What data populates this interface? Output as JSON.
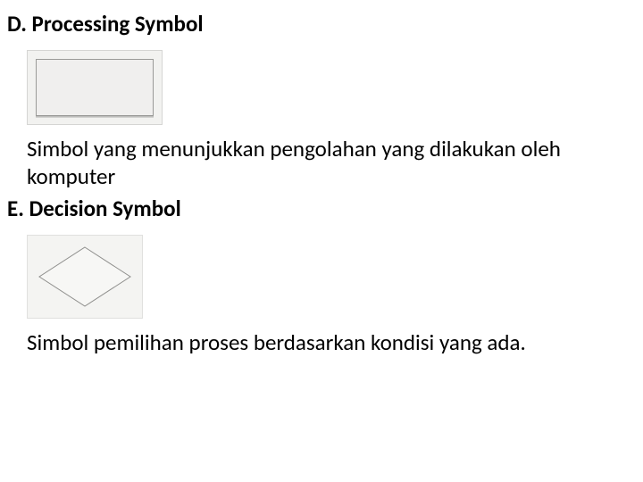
{
  "sections": {
    "processing": {
      "heading": "D. Processing Symbol",
      "description": "Simbol yang menunjukkan pengolahan yang dilakukan oleh komputer"
    },
    "decision": {
      "heading": "E. Decision Symbol",
      "description": "Simbol pemilihan proses berdasarkan kondisi yang ada."
    }
  }
}
